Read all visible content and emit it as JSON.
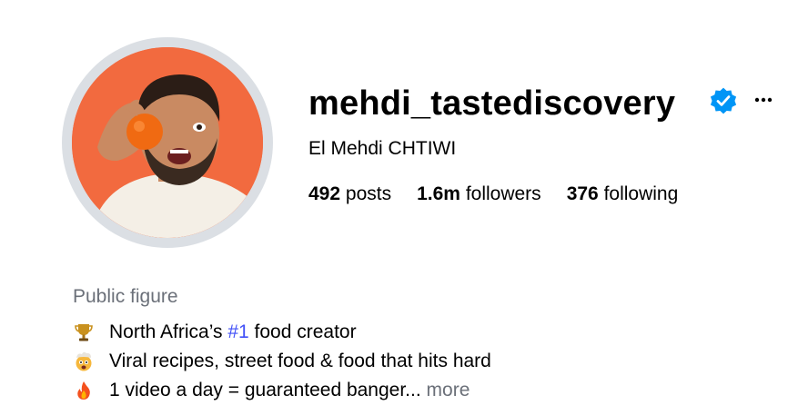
{
  "profile": {
    "username": "mehdi_tastediscovery",
    "full_name": "El Mehdi CHTIWI",
    "verified_icon": "verified-badge-icon",
    "options_icon": "more-options-icon",
    "stats": {
      "posts_count": "492",
      "posts_label": "posts",
      "followers_count": "1.6m",
      "followers_label": "followers",
      "following_count": "376",
      "following_label": "following"
    },
    "category": "Public figure",
    "bio": {
      "line1_emoji": "trophy-icon",
      "line1_pre": "North Africa’s ",
      "line1_link": "#1",
      "line1_post": " food creator",
      "line2_emoji": "exploding-head-icon",
      "line2_text": "Viral recipes, street food & food that hits hard",
      "line3_emoji": "fire-icon",
      "line3_text": "1 video a day = guaranteed banger...",
      "more_label": "more"
    }
  },
  "colors": {
    "avatar_background": "#f26a3f",
    "verified_blue": "#0095f6",
    "link_blue": "#4150f7",
    "secondary_text": "#6b7079"
  }
}
